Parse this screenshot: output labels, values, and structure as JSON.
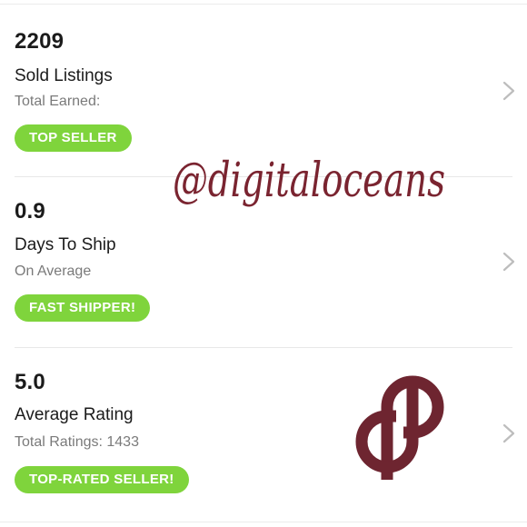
{
  "stats": [
    {
      "value": "2209",
      "label": "Sold Listings",
      "sub": "Total Earned:",
      "badge": "TOP SELLER"
    },
    {
      "value": "0.9",
      "label": "Days To Ship",
      "sub": "On Average",
      "badge": "FAST SHIPPER!"
    },
    {
      "value": "5.0",
      "label": "Average Rating",
      "sub": "Total Ratings: 1433",
      "badge": "TOP-RATED SELLER!"
    }
  ],
  "watermark": {
    "text": "@digitaloceans",
    "color": "#7a2430"
  },
  "colors": {
    "badge": "#7fd43c",
    "chevron": "#bdbdbd",
    "logo": "#6e2530"
  },
  "icons": {
    "chevron": "chevron-right-icon",
    "logo": "poshmark-logo-icon"
  }
}
